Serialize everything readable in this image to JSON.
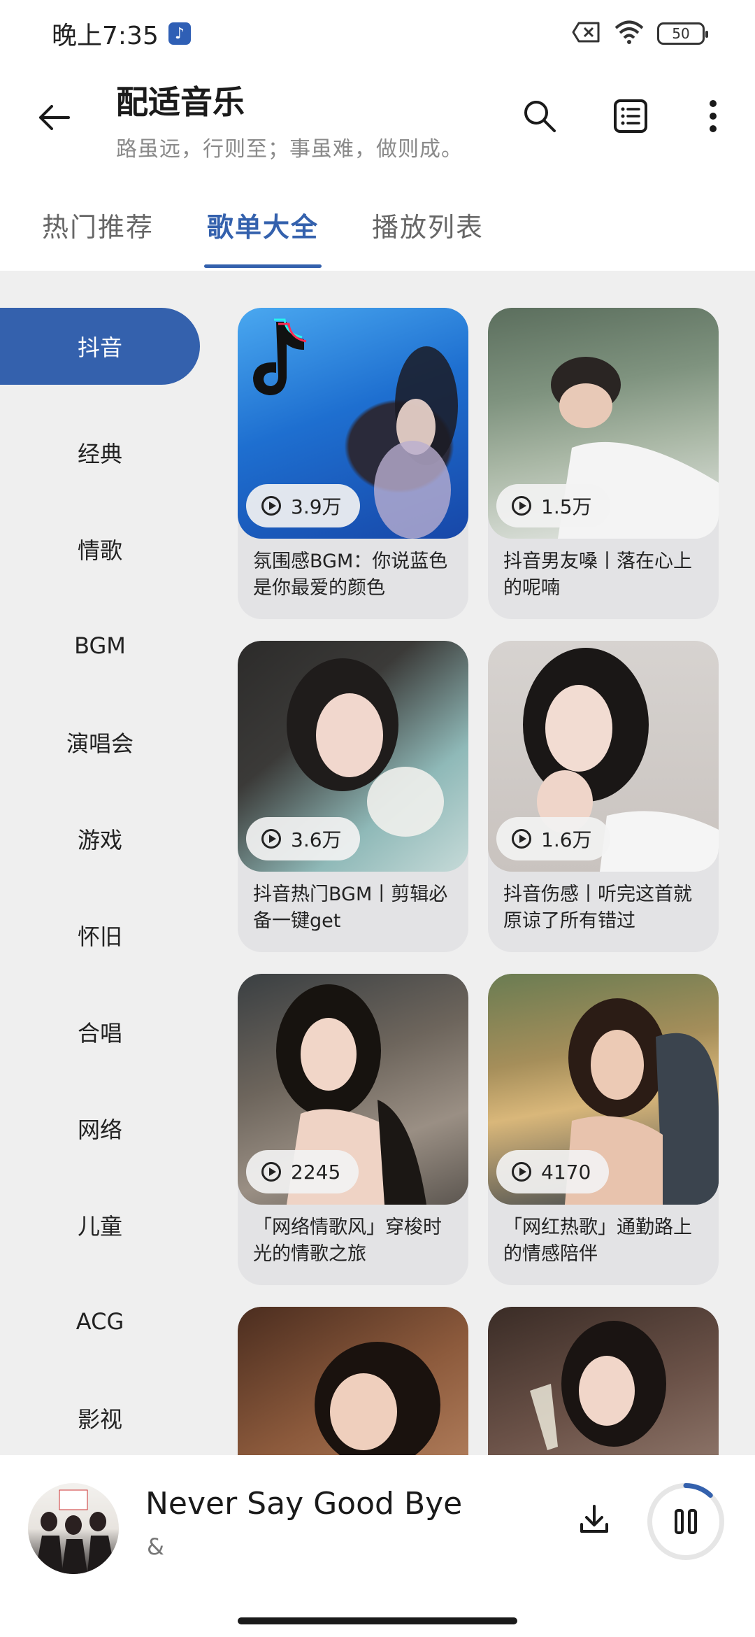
{
  "status_bar": {
    "time": "晚上7:35",
    "battery": "50"
  },
  "header": {
    "title": "配适音乐",
    "subtitle": "路虽远，行则至；事虽难，做则成。"
  },
  "tabs": [
    "热门推荐",
    "歌单大全",
    "播放列表"
  ],
  "active_tab": "歌单大全",
  "categories": [
    "抖音",
    "经典",
    "情歌",
    "BGM",
    "演唱会",
    "游戏",
    "怀旧",
    "合唱",
    "网络",
    "儿童",
    "ACG",
    "影视"
  ],
  "active_category": "抖音",
  "playlists": [
    {
      "plays": "3.9万",
      "title": "氛围感BGM：你说蓝色是你最爱的颜色"
    },
    {
      "plays": "1.5万",
      "title": "抖音男友嗓丨落在心上的呢喃"
    },
    {
      "plays": "3.6万",
      "title": "抖音热门BGM丨剪辑必备一键get"
    },
    {
      "plays": "1.6万",
      "title": "抖音伤感丨听完这首就原谅了所有错过"
    },
    {
      "plays": "2245",
      "title": "「网络情歌风」穿梭时光的情歌之旅"
    },
    {
      "plays": "4170",
      "title": "「网红热歌」通勤路上的情感陪伴"
    },
    {
      "plays": "",
      "title": ""
    },
    {
      "plays": "",
      "title": ""
    }
  ],
  "player": {
    "song_title": "Never Say Good Bye",
    "artist": "&",
    "progress": 0.12
  },
  "colors": {
    "accent": "#3461ad",
    "background": "#efefef",
    "card": "#e3e3e5"
  }
}
